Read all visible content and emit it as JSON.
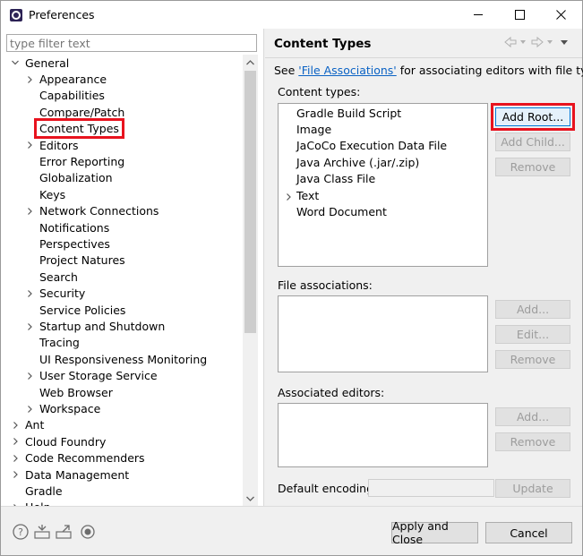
{
  "window": {
    "title": "Preferences",
    "minimize_glyph": "—",
    "maximize_glyph": "☐",
    "close_glyph": "✕"
  },
  "filter": {
    "placeholder": "type filter text",
    "value": ""
  },
  "tree": {
    "items": [
      {
        "label": "General",
        "level": 0,
        "expanded": true,
        "has_children": true
      },
      {
        "label": "Appearance",
        "level": 1,
        "has_children": true
      },
      {
        "label": "Capabilities",
        "level": 1,
        "has_children": false
      },
      {
        "label": "Compare/Patch",
        "level": 1,
        "has_children": false
      },
      {
        "label": "Content Types",
        "level": 1,
        "has_children": false,
        "selected": true
      },
      {
        "label": "Editors",
        "level": 1,
        "has_children": true
      },
      {
        "label": "Error Reporting",
        "level": 1,
        "has_children": false
      },
      {
        "label": "Globalization",
        "level": 1,
        "has_children": false
      },
      {
        "label": "Keys",
        "level": 1,
        "has_children": false
      },
      {
        "label": "Network Connections",
        "level": 1,
        "has_children": true
      },
      {
        "label": "Notifications",
        "level": 1,
        "has_children": false
      },
      {
        "label": "Perspectives",
        "level": 1,
        "has_children": false
      },
      {
        "label": "Project Natures",
        "level": 1,
        "has_children": false
      },
      {
        "label": "Search",
        "level": 1,
        "has_children": false
      },
      {
        "label": "Security",
        "level": 1,
        "has_children": true
      },
      {
        "label": "Service Policies",
        "level": 1,
        "has_children": false
      },
      {
        "label": "Startup and Shutdown",
        "level": 1,
        "has_children": true
      },
      {
        "label": "Tracing",
        "level": 1,
        "has_children": false
      },
      {
        "label": "UI Responsiveness Monitoring",
        "level": 1,
        "has_children": false
      },
      {
        "label": "User Storage Service",
        "level": 1,
        "has_children": true
      },
      {
        "label": "Web Browser",
        "level": 1,
        "has_children": false
      },
      {
        "label": "Workspace",
        "level": 1,
        "has_children": true
      },
      {
        "label": "Ant",
        "level": 0,
        "has_children": true
      },
      {
        "label": "Cloud Foundry",
        "level": 0,
        "has_children": true
      },
      {
        "label": "Code Recommenders",
        "level": 0,
        "has_children": true
      },
      {
        "label": "Data Management",
        "level": 0,
        "has_children": true
      },
      {
        "label": "Gradle",
        "level": 0,
        "has_children": false
      },
      {
        "label": "Help",
        "level": 0,
        "has_children": true
      }
    ]
  },
  "page": {
    "title": "Content Types",
    "description_prefix": "See ",
    "description_link": "'File Associations'",
    "description_suffix": " for associating editors with file types.",
    "content_types_label": "Content types:",
    "content_types": [
      {
        "label": "Gradle Build Script",
        "has_children": false
      },
      {
        "label": "Image",
        "has_children": false
      },
      {
        "label": "JaCoCo Execution Data File",
        "has_children": false
      },
      {
        "label": "Java Archive (.jar/.zip)",
        "has_children": false
      },
      {
        "label": "Java Class File",
        "has_children": false
      },
      {
        "label": "Text",
        "has_children": true
      },
      {
        "label": "Word Document",
        "has_children": false
      }
    ],
    "buttons": {
      "add_root": "Add Root...",
      "add_child": "Add Child...",
      "remove": "Remove",
      "fa_add": "Add...",
      "fa_edit": "Edit...",
      "fa_remove": "Remove",
      "ae_add": "Add...",
      "ae_remove": "Remove",
      "update": "Update"
    },
    "file_associations_label": "File associations:",
    "associated_editors_label": "Associated editors:",
    "default_encoding_label": "Default encoding:",
    "default_encoding_value": ""
  },
  "bottom": {
    "apply_close": "Apply and Close",
    "cancel": "Cancel"
  },
  "colors": {
    "highlight_outline": "#e8131e",
    "link": "#0a62c4",
    "disabled_text": "#9c9c9c"
  }
}
